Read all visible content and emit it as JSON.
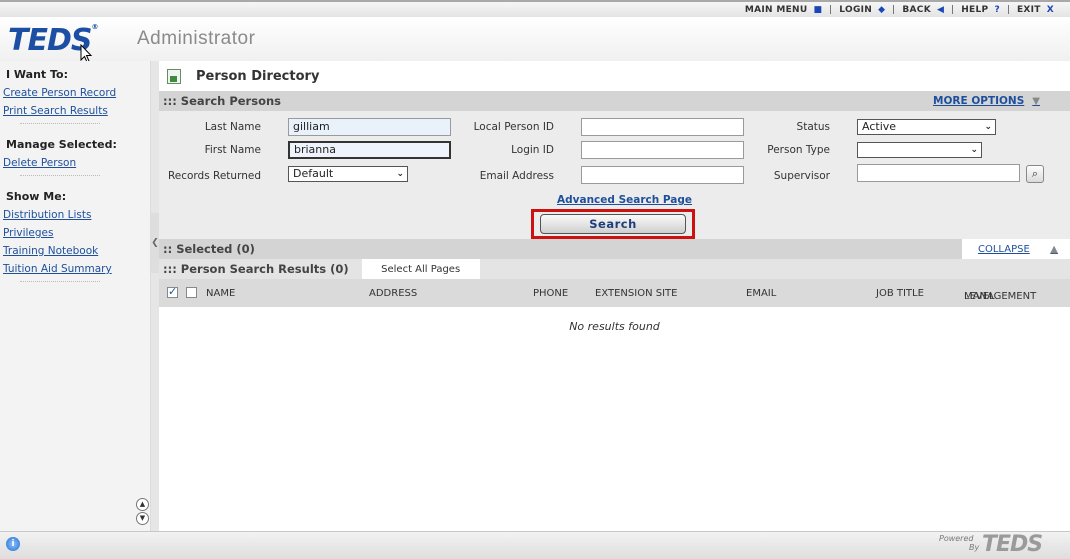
{
  "topnav": {
    "items": [
      {
        "label": "MAIN MENU",
        "icon": "■"
      },
      {
        "label": "LOGIN",
        "icon": "◆"
      },
      {
        "label": "BACK",
        "icon": "◀"
      },
      {
        "label": "HELP",
        "icon": "?"
      },
      {
        "label": "EXIT",
        "icon": "X"
      }
    ]
  },
  "header": {
    "logo_text": "TEDS",
    "logo_mark": "®",
    "app_title": "Administrator"
  },
  "sidebar": {
    "i_want_to": "I Want To:",
    "i_want_to_links": [
      "Create Person Record",
      "Print Search Results"
    ],
    "manage_selected": "Manage Selected:",
    "manage_links": [
      "Delete Person"
    ],
    "show_me": "Show Me:",
    "show_links": [
      "Distribution Lists",
      "Privileges",
      "Training Notebook",
      "Tuition Aid Summary"
    ]
  },
  "page": {
    "title": "Person Directory"
  },
  "search_panel": {
    "header": "::: Search Persons",
    "more_options": "MORE OPTIONS",
    "fields": {
      "last_name_label": "Last Name",
      "last_name_value": "gilliam",
      "first_name_label": "First Name",
      "first_name_value": "brianna",
      "records_returned_label": "Records Returned",
      "records_returned_value": "Default",
      "local_person_id_label": "Local Person ID",
      "local_person_id_value": "",
      "login_id_label": "Login ID",
      "login_id_value": "",
      "email_label": "Email Address",
      "email_value": "",
      "status_label": "Status",
      "status_value": "Active",
      "person_type_label": "Person Type",
      "person_type_value": "",
      "supervisor_label": "Supervisor",
      "supervisor_value": ""
    },
    "advanced_link": "Advanced Search Page",
    "search_button": "Search"
  },
  "selected": {
    "header": ":: Selected (0)",
    "collapse": "COLLAPSE"
  },
  "results": {
    "header": "::: Person Search Results (0)",
    "select_all_tab": "Select All Pages",
    "columns": [
      "NAME",
      "ADDRESS",
      "PHONE",
      "EXTENSION SITE",
      "EMAIL",
      "JOB TITLE",
      "MANAGEMENT",
      "LEVEL"
    ],
    "empty_message": "No results found"
  },
  "footer": {
    "powered": "Powered",
    "by": "By",
    "logo": "TEDS"
  },
  "colors": {
    "link": "#1e4f9c",
    "logo": "#1c4fa3",
    "highlight": "#cc1111"
  }
}
